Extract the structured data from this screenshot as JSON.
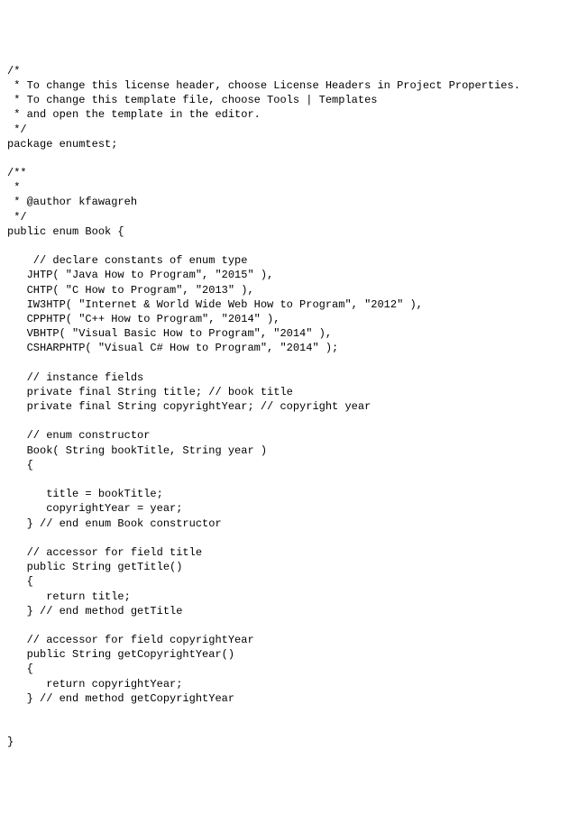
{
  "code": {
    "lines": [
      "/*",
      " * To change this license header, choose License Headers in Project Properties.",
      " * To change this template file, choose Tools | Templates",
      " * and open the template in the editor.",
      " */",
      "package enumtest;",
      "",
      "/**",
      " *",
      " * @author kfawagreh",
      " */",
      "public enum Book {",
      "",
      "    // declare constants of enum type",
      "   JHTP( \"Java How to Program\", \"2015\" ),",
      "   CHTP( \"C How to Program\", \"2013\" ),",
      "   IW3HTP( \"Internet & World Wide Web How to Program\", \"2012\" ),",
      "   CPPHTP( \"C++ How to Program\", \"2014\" ),",
      "   VBHTP( \"Visual Basic How to Program\", \"2014\" ),",
      "   CSHARPHTP( \"Visual C# How to Program\", \"2014\" );",
      "",
      "   // instance fields",
      "   private final String title; // book title",
      "   private final String copyrightYear; // copyright year",
      "",
      "   // enum constructor",
      "   Book( String bookTitle, String year )",
      "   {",
      "",
      "      title = bookTitle;",
      "      copyrightYear = year;",
      "   } // end enum Book constructor",
      "",
      "   // accessor for field title",
      "   public String getTitle()",
      "   {",
      "      return title;",
      "   } // end method getTitle",
      "",
      "   // accessor for field copyrightYear",
      "   public String getCopyrightYear()",
      "   {",
      "      return copyrightYear;",
      "   } // end method getCopyrightYear",
      "",
      "",
      "}"
    ]
  }
}
